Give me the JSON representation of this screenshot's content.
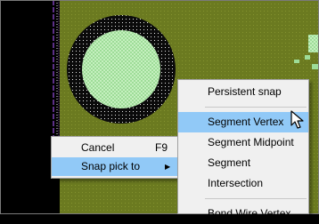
{
  "colors": {
    "board": "#6b7a20",
    "board_dots": "#7f8f35",
    "pad_ring": "#0b0b0b",
    "pad_fill": "#b6eab0",
    "outline": "#5b2f86",
    "highlight": "#91c9f7"
  },
  "context_menu": {
    "items": [
      {
        "label": "Cancel",
        "shortcut": "F9"
      },
      {
        "label": "Snap pick to",
        "arrow": "▶"
      }
    ]
  },
  "snap_submenu": {
    "items": [
      {
        "label": "Persistent snap"
      },
      {
        "label": "Segment Vertex"
      },
      {
        "label": "Segment Midpoint"
      },
      {
        "label": "Segment"
      },
      {
        "label": "Intersection"
      },
      {
        "label": "Bond Wire Vertex"
      }
    ]
  }
}
